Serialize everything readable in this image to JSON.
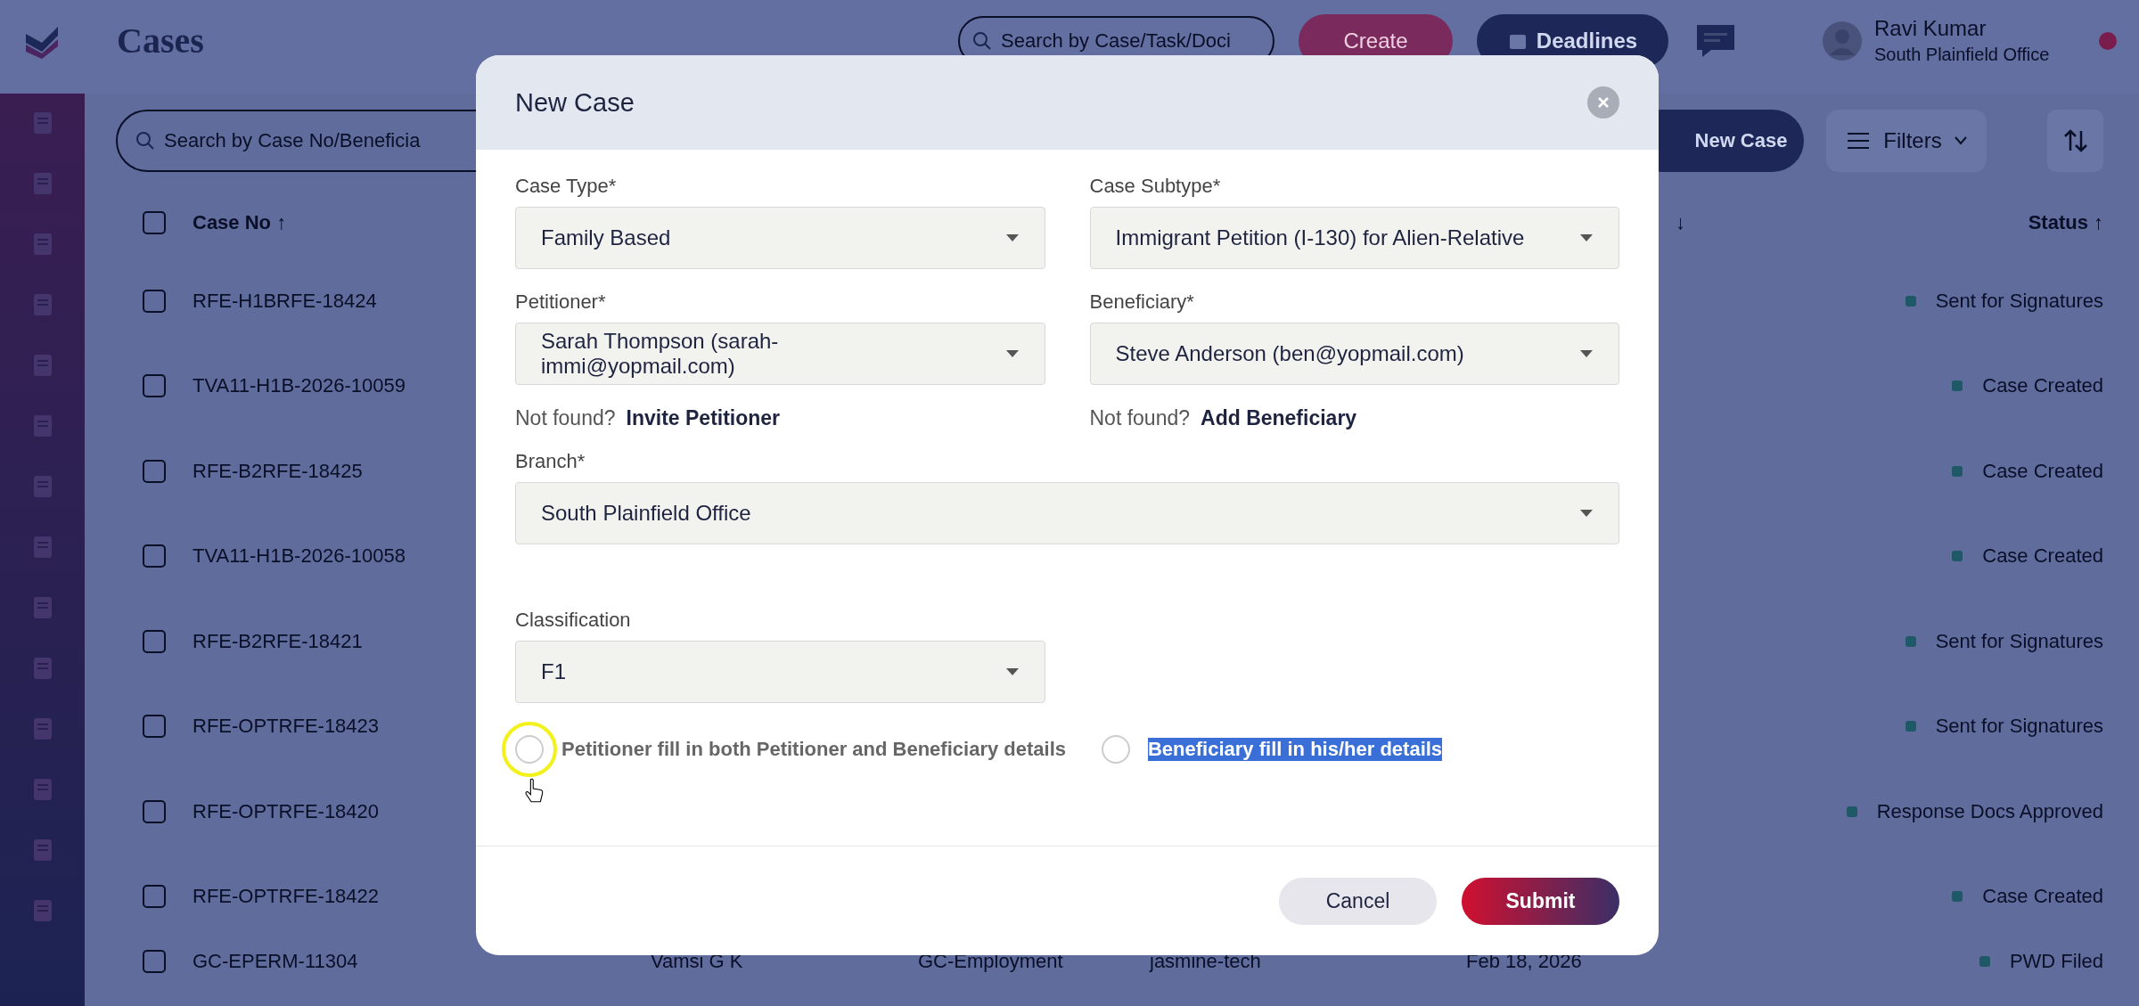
{
  "header": {
    "title": "Cases",
    "search": {
      "placeholder": "Search by Case/Task/Doci"
    },
    "create_button": "Create",
    "deadlines_button": "Deadlines",
    "user": {
      "name": "Ravi Kumar",
      "office": "South Plainfield Office"
    }
  },
  "toolbar": {
    "search": {
      "placeholder": "Search by Case No/Beneficia"
    },
    "new_case_button": "New Case",
    "filters_button": "Filters"
  },
  "table": {
    "select_all_checked": false,
    "columns": [
      {
        "label": "Case No ↑"
      },
      {
        "label": "↓"
      },
      {
        "label": "Status ↑"
      }
    ],
    "rows": [
      {
        "checked": false,
        "case_no": "RFE-H1BRFE-18424",
        "status": "Sent for Signatures"
      },
      {
        "checked": false,
        "case_no": "TVA11-H1B-2026-10059",
        "status": "Case Created"
      },
      {
        "checked": false,
        "case_no": "RFE-B2RFE-18425",
        "status": "Case Created"
      },
      {
        "checked": false,
        "case_no": "TVA11-H1B-2026-10058",
        "status": "Case Created"
      },
      {
        "checked": false,
        "case_no": "RFE-B2RFE-18421",
        "status": "Sent for Signatures"
      },
      {
        "checked": false,
        "case_no": "RFE-OPTRFE-18423",
        "status": "Sent for Signatures"
      },
      {
        "checked": false,
        "case_no": "RFE-OPTRFE-18420",
        "status": "Response Docs Approved"
      },
      {
        "checked": false,
        "case_no": "RFE-OPTRFE-18422",
        "status": "Case Created"
      },
      {
        "checked": false,
        "case_no": "GC-EPERM-11304",
        "beneficiary": "Vamsi G K",
        "type": "GC-Employment",
        "company": "jasmine-tech",
        "date": "Feb 18, 2026",
        "status": "PWD Filed"
      }
    ]
  },
  "modal": {
    "title": "New Case",
    "fields": [
      {
        "label": "Case Type*",
        "value": "Family Based"
      },
      {
        "label": "Case Subtype*",
        "value": "Immigrant Petition (I-130) for Alien-Relative"
      },
      {
        "label": "Petitioner*",
        "value": "Sarah Thompson (sarah-immi@yopmail.com)"
      },
      {
        "label": "Beneficiary*",
        "value": "Steve Anderson (ben@yopmail.com)"
      }
    ],
    "not_found": [
      {
        "prefix": "Not found?",
        "link": "Invite Petitioner"
      },
      {
        "prefix": "Not found?",
        "link": "Add Beneficiary"
      }
    ],
    "branch": {
      "label": "Branch*",
      "value": "South Plainfield Office"
    },
    "classification": {
      "label": "Classification",
      "value": "F1"
    },
    "radios": [
      {
        "label": "Petitioner fill in both Petitioner and Beneficiary details",
        "selected": false,
        "text_highlighted": false
      },
      {
        "label": "Beneficiary fill in his/her details",
        "selected": false,
        "text_highlighted": true
      }
    ],
    "cancel_button": "Cancel",
    "submit_button": "Submit"
  }
}
